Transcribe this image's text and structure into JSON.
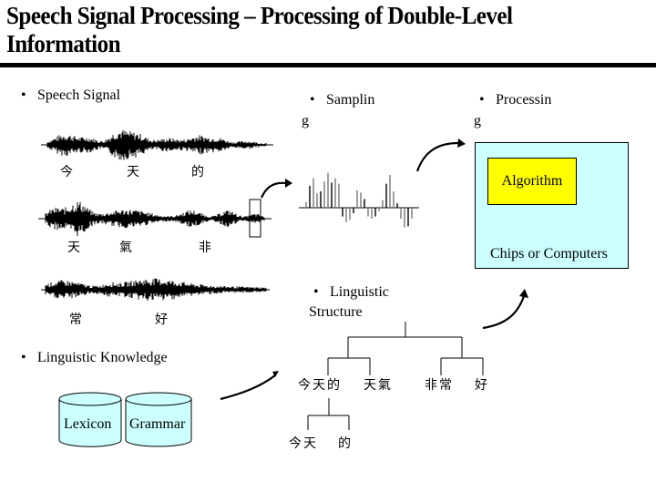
{
  "slide": {
    "title_line1": "Speech Signal Processing – Processing of Double-Level",
    "title_line2": "Information"
  },
  "sections": {
    "speech_signal": "Speech Signal",
    "sampling_part1": "Samplin",
    "sampling_part2": "g",
    "processing_part1": "Processin",
    "processing_part2": "g",
    "linguistic_structure_line1": "Linguistic",
    "linguistic_structure_line2": "Structure",
    "linguistic_knowledge": "Linguistic Knowledge"
  },
  "bullet_glyph": "•",
  "waveforms": {
    "row1_labels": [
      "今",
      "天",
      "的"
    ],
    "row2_labels": [
      "天",
      "氣",
      "非"
    ],
    "row3_labels": [
      "常",
      "好"
    ]
  },
  "processing_box": {
    "algorithm_label": "Algorithm",
    "container_label": "Chips or Computers",
    "container_color": "#ccffff",
    "algorithm_color": "#ffff00"
  },
  "knowledge": {
    "cylinders": [
      "Lexicon",
      "Grammar"
    ],
    "cylinder_color": "#ccffff"
  },
  "parse_tree": {
    "level1": [
      "今天的",
      "天氣",
      "非常",
      "好"
    ],
    "level2": [
      "今天",
      "的"
    ]
  }
}
